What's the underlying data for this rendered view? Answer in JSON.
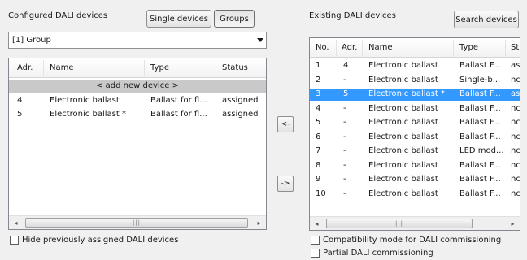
{
  "left_panel": {
    "title": "Configured DALI devices",
    "single_devices_btn": "Single devices",
    "groups_btn": "Groups",
    "group_select_value": "[1] Group",
    "columns": {
      "adr": "Adr.",
      "name": "Name",
      "type": "Type",
      "status": "Status"
    },
    "add_row": "< add new device >",
    "rows": [
      {
        "adr": "4",
        "name": "Electronic ballast",
        "type": "Ballast for fl...",
        "status": "assigned"
      },
      {
        "adr": "5",
        "name": "Electronic ballast *",
        "type": "Ballast for fl...",
        "status": "assigned"
      }
    ],
    "hide_checkbox_label": "Hide previously assigned DALI devices"
  },
  "middle": {
    "move_left_btn": "<-",
    "move_right_btn": "->"
  },
  "right_panel": {
    "title": "Existing DALI devices",
    "search_btn": "Search devices",
    "columns": {
      "no": "No.",
      "adr": "Adr.",
      "name": "Name",
      "type": "Type",
      "st": "St"
    },
    "selected_index": 2,
    "rows": [
      {
        "no": "1",
        "adr": "4",
        "name": "Electronic ballast",
        "type": "Ballast F...",
        "st": "as"
      },
      {
        "no": "2",
        "adr": "-",
        "name": "Electronic ballast",
        "type": "Single-b...",
        "st": "nc"
      },
      {
        "no": "3",
        "adr": "5",
        "name": "Electronic ballast *",
        "type": "Ballast F...",
        "st": "as"
      },
      {
        "no": "4",
        "adr": "-",
        "name": "Electronic ballast",
        "type": "Ballast F...",
        "st": "nc"
      },
      {
        "no": "5",
        "adr": "-",
        "name": "Electronic ballast",
        "type": "Ballast F...",
        "st": "nc"
      },
      {
        "no": "6",
        "adr": "-",
        "name": "Electronic ballast",
        "type": "Ballast F...",
        "st": "nc"
      },
      {
        "no": "7",
        "adr": "-",
        "name": "Electronic ballast",
        "type": "LED mod...",
        "st": "nc"
      },
      {
        "no": "8",
        "adr": "-",
        "name": "Electronic ballast",
        "type": "Ballast F...",
        "st": "nc"
      },
      {
        "no": "9",
        "adr": "-",
        "name": "Electronic ballast",
        "type": "Ballast F...",
        "st": "nc"
      },
      {
        "no": "10",
        "adr": "-",
        "name": "Electronic ballast",
        "type": "Ballast F...",
        "st": "nc"
      }
    ],
    "compat_checkbox_label": "Compatibility mode for DALI commissioning",
    "partial_checkbox_label": "Partial DALI commissioning"
  },
  "scrollbar": {
    "grip": "|||",
    "left_arrow": "◂",
    "right_arrow": "▸"
  },
  "colors": {
    "selection": "#3399ff",
    "add_row": "#c9c9c9"
  }
}
